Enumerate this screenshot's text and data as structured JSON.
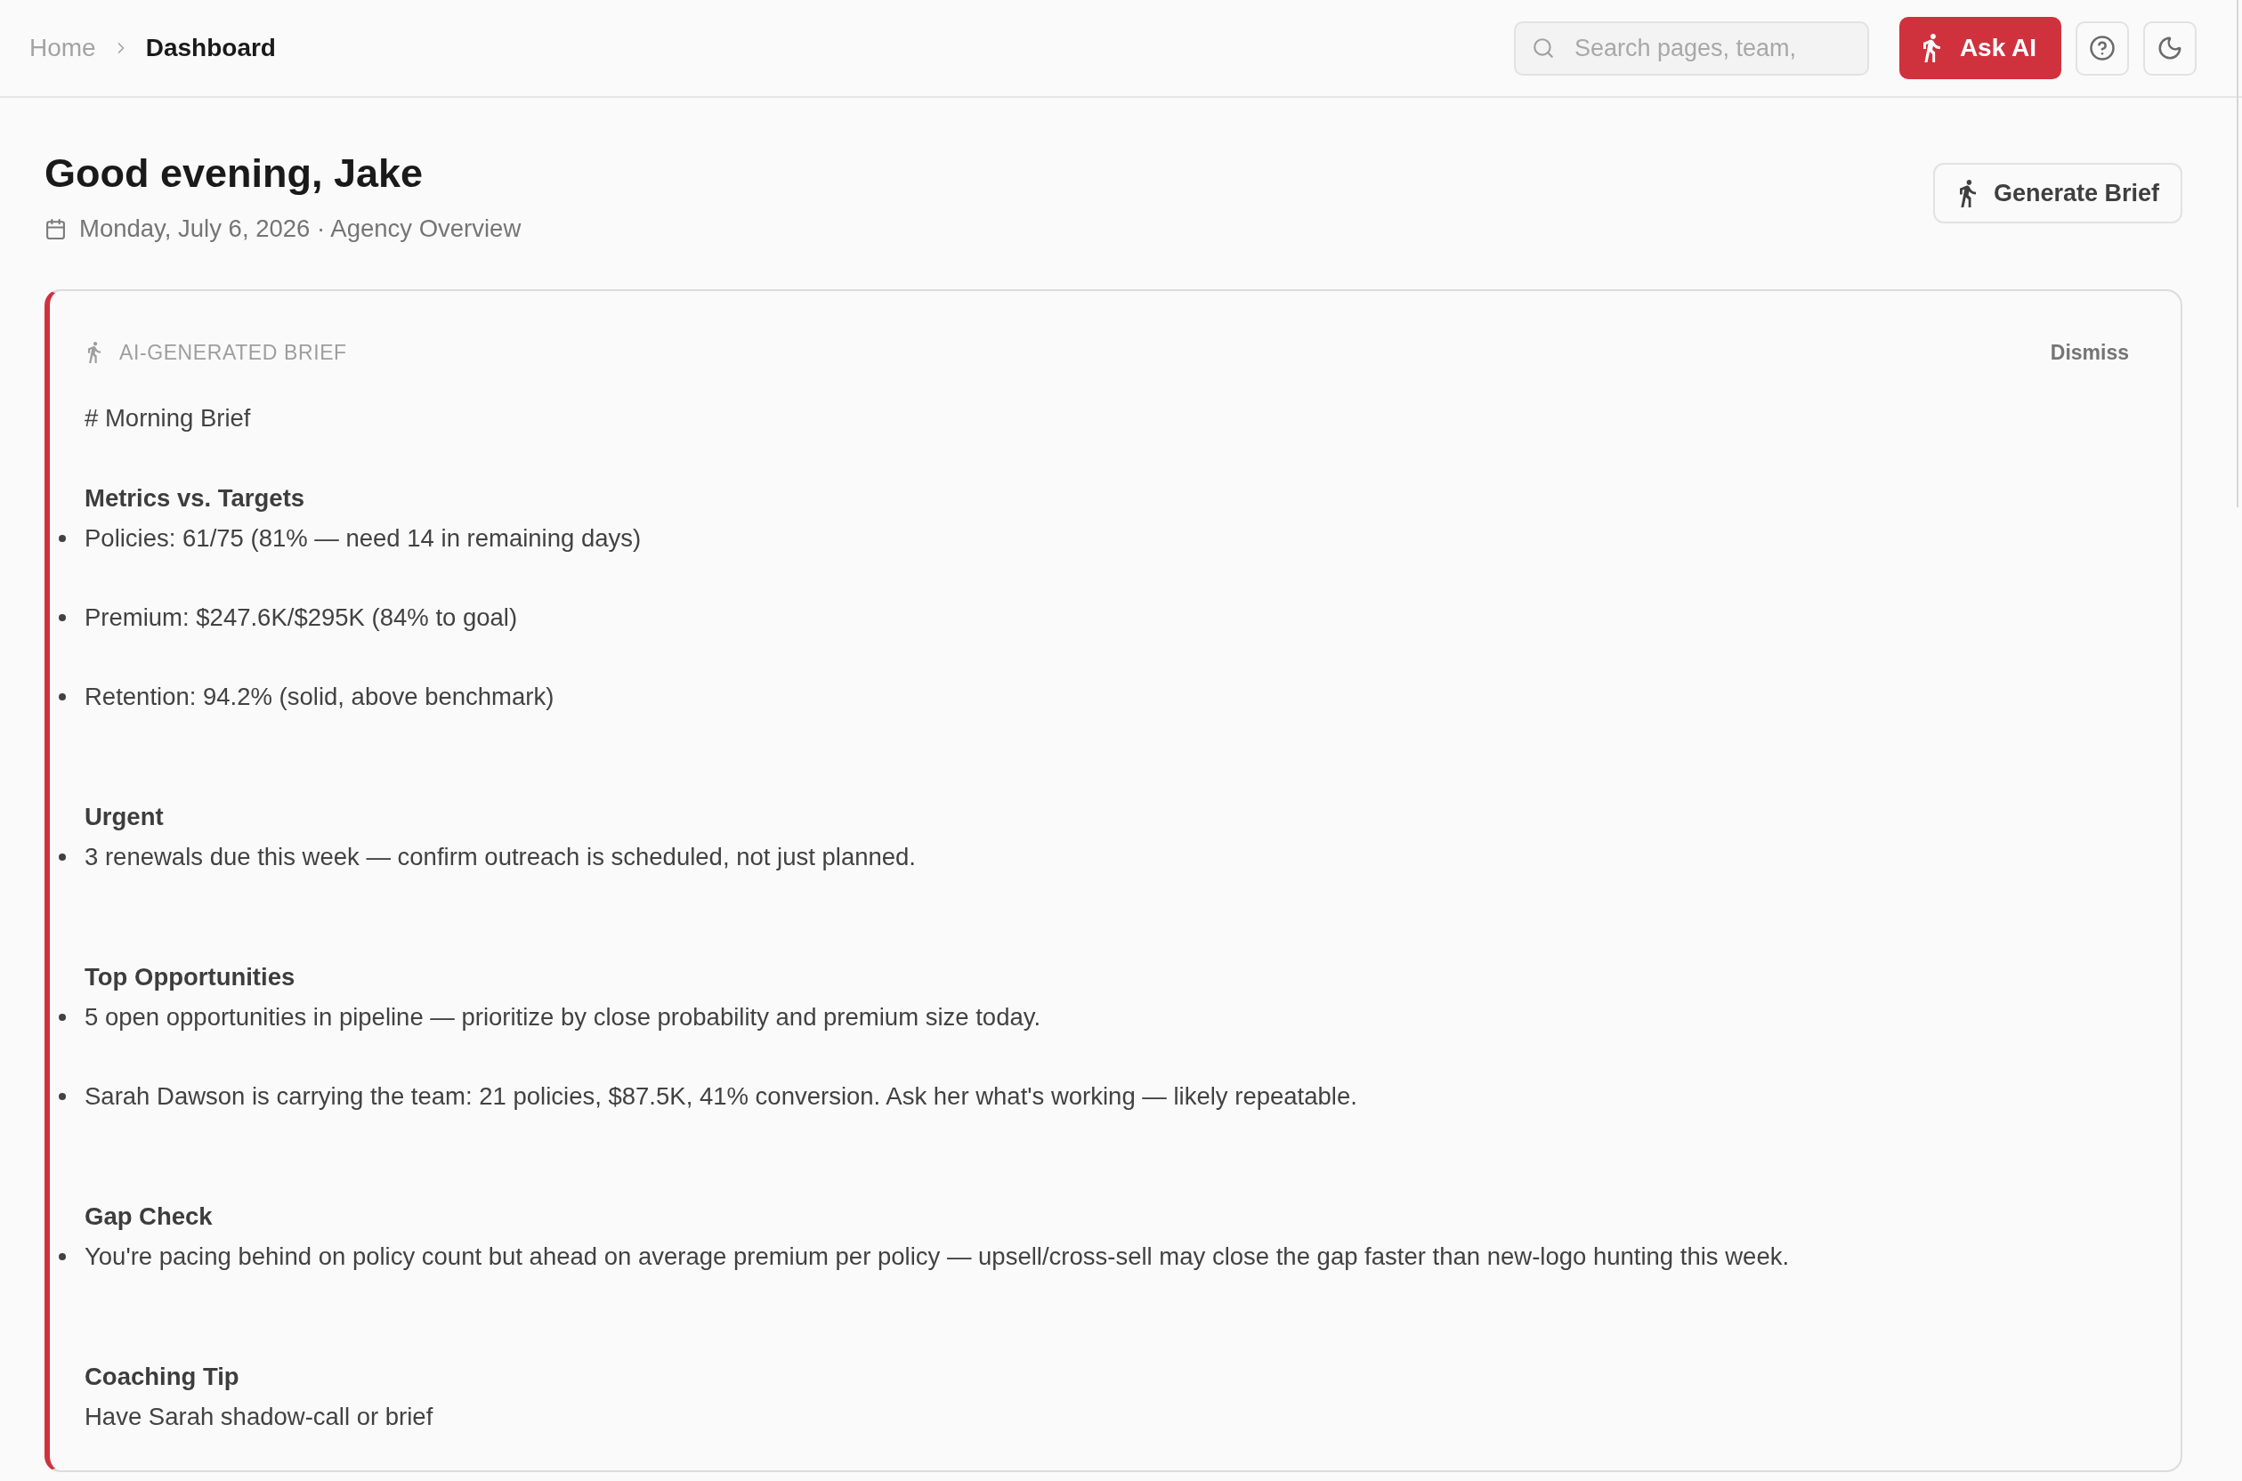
{
  "topbar": {
    "breadcrumb": [
      {
        "label": "Home",
        "current": false
      },
      {
        "label": "Dashboard",
        "current": true
      }
    ],
    "search": {
      "placeholder": "Search pages, team,"
    },
    "ask_ai": {
      "label": "Ask AI"
    }
  },
  "header": {
    "title": "Good evening, Jake",
    "subtitle": "Monday, July 6, 2026 · Agency Overview",
    "action": "Generate Brief"
  },
  "brief": {
    "label": "AI-GENERATED BRIEF",
    "dismiss": "Dismiss",
    "title": "# Morning Brief",
    "sections": [
      {
        "heading": "Metrics vs. Targets",
        "lines": [
          {
            "kind": "bullet",
            "text": "Policies: 61/75 (81% — need 14 in remaining days)"
          },
          {
            "kind": "bullet",
            "text": "Premium: $247.6K/$295K (84% to goal)"
          },
          {
            "kind": "bullet",
            "text": "Retention: 94.2% (solid, above benchmark)"
          }
        ]
      },
      {
        "heading": "Urgent",
        "lines": [
          {
            "kind": "bullet",
            "text": "3 renewals due this week — confirm outreach is scheduled, not just planned."
          }
        ]
      },
      {
        "heading": "Top Opportunities",
        "lines": [
          {
            "kind": "bullet",
            "text": "5 open opportunities in pipeline — prioritize by close probability and premium size today."
          },
          {
            "kind": "bullet",
            "text": "Sarah Dawson is carrying the team: 21 policies, $87.5K, 41% conversion. Ask her what's working — likely repeatable."
          }
        ]
      },
      {
        "heading": "Gap Check",
        "lines": [
          {
            "kind": "bullet",
            "text": "You're pacing behind on policy count but ahead on average premium per policy — upsell/cross-sell may close the gap faster than new-logo hunting this week."
          }
        ]
      },
      {
        "heading": "Coaching Tip",
        "lines": [
          {
            "kind": "text",
            "text": "Have Sarah shadow-call or brief"
          }
        ]
      }
    ]
  }
}
